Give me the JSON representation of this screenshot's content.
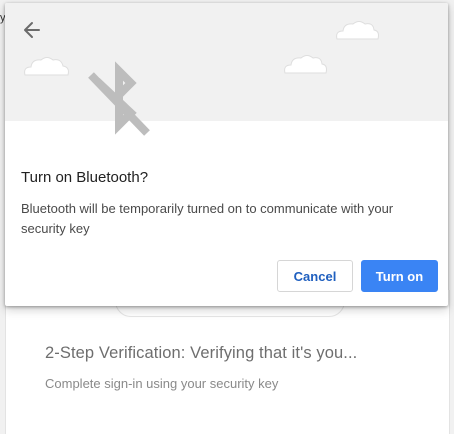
{
  "background": {
    "top_fragment": "y",
    "title": "2-Step Verification: Verifying that it's you...",
    "subtitle": "Complete sign-in using your security key"
  },
  "dialog": {
    "back_icon": "arrow-back-icon",
    "illustration_icon": "bluetooth-disabled-icon",
    "title": "Turn on Bluetooth?",
    "body": "Bluetooth will be temporarily turned on to communicate with your security key",
    "cancel_label": "Cancel",
    "confirm_label": "Turn on"
  },
  "colors": {
    "primary": "#3a84f4",
    "link_text": "#1f5fbf",
    "header_bg": "#f1f1f1",
    "icon_gray": "#bdbdbd"
  }
}
